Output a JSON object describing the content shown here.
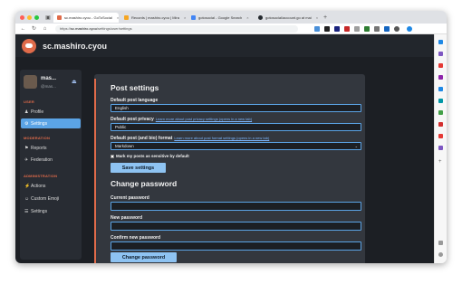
{
  "browser": {
    "tabs": [
      {
        "label": "sc.mashiro.cyou - GoToSocial",
        "favicon_color": "#e06b4a",
        "active": true
      },
      {
        "label": "Records | mashiro.cyou | Mira",
        "favicon_color": "#f5a623",
        "active": false
      },
      {
        "label": "gotosocial - Google Search",
        "favicon_color": "#4285f4",
        "active": false
      },
      {
        "label": "gotosocial/account.go at mai",
        "favicon_color": "#24292e",
        "active": false
      }
    ],
    "new_tab": "+",
    "url_prefix": "https://",
    "url_host": "sc.mashiro.cyou",
    "url_path": "/settings/user/settings"
  },
  "site": {
    "title": "sc.mashiro.cyou"
  },
  "sidebar": {
    "user_name": "mas...",
    "user_handle": "@mas...",
    "sections": [
      {
        "heading": "USER",
        "items": [
          {
            "label": "Profile",
            "icon": "user-icon",
            "glyph": "♟",
            "active": false
          },
          {
            "label": "Settings",
            "icon": "gear-icon",
            "glyph": "⚙",
            "active": true
          }
        ]
      },
      {
        "heading": "MODERATION",
        "items": [
          {
            "label": "Reports",
            "icon": "flag-icon",
            "glyph": "⚑",
            "active": false
          },
          {
            "label": "Federation",
            "icon": "plane-icon",
            "glyph": "✈",
            "active": false
          }
        ]
      },
      {
        "heading": "ADMINISTRATION",
        "items": [
          {
            "label": "Actions",
            "icon": "bolt-icon",
            "glyph": "⚡",
            "active": false
          },
          {
            "label": "Custom Emoji",
            "icon": "smile-icon",
            "glyph": "☺",
            "active": false
          },
          {
            "label": "Settings",
            "icon": "sliders-icon",
            "glyph": "☰",
            "active": false
          }
        ]
      }
    ]
  },
  "post_settings": {
    "heading": "Post settings",
    "language_label": "Default post language",
    "language_value": "English",
    "privacy_label": "Default post privacy",
    "privacy_link": "Learn more about post privacy settings (opens in a new tab)",
    "privacy_value": "Public",
    "format_label": "Default post (and bio) format",
    "format_link": "Learn more about post format settings (opens in a new tab)",
    "format_value": "Markdown",
    "sensitive_label": "Mark my posts as sensitive by default",
    "save_button": "Save settings"
  },
  "change_password": {
    "heading": "Change password",
    "current_label": "Current password",
    "new_label": "New password",
    "confirm_label": "Confirm new password",
    "button": "Change password"
  },
  "colors": {
    "accent": "#e06b4a",
    "button": "#8ec3f2",
    "active_nav": "#5ba4e6",
    "page_bg": "#1c1f24",
    "panel_bg": "#33373e"
  }
}
